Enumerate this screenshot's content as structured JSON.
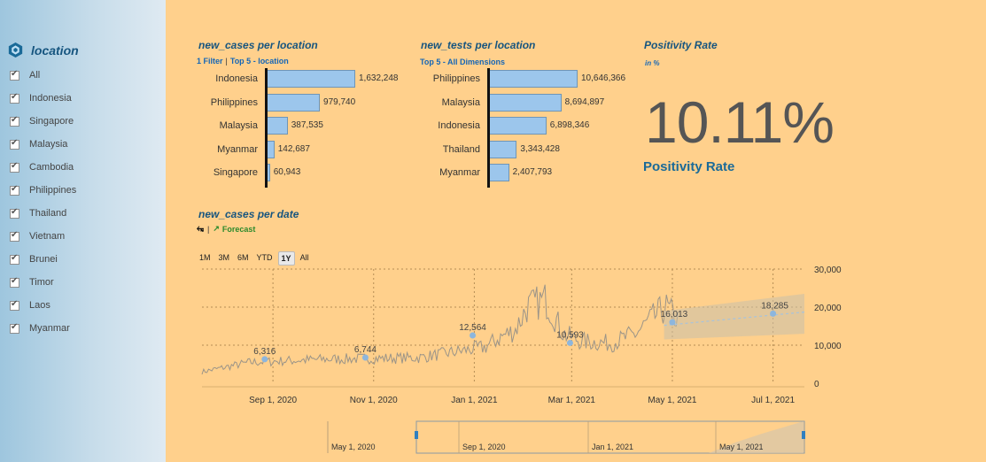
{
  "sidebar": {
    "title": "location",
    "items": [
      "All",
      "Indonesia",
      "Singapore",
      "Malaysia",
      "Cambodia",
      "Philippines",
      "Thailand",
      "Vietnam",
      "Brunei",
      "Timor",
      "Laos",
      "Myanmar"
    ]
  },
  "panel_cases": {
    "title": "new_cases per location",
    "filter_label": "1 Filter",
    "subtitle": "Top 5 - location",
    "chart_data": {
      "type": "bar",
      "categories": [
        "Indonesia",
        "Philippines",
        "Malaysia",
        "Myanmar",
        "Singapore"
      ],
      "values": [
        1632248,
        979740,
        387535,
        142687,
        60943
      ],
      "value_labels": [
        "1,632,248",
        "979,740",
        "387,535",
        "142,687",
        "60,943"
      ]
    }
  },
  "panel_tests": {
    "title": "new_tests per location",
    "subtitle": "Top 5 - All Dimensions",
    "chart_data": {
      "type": "bar",
      "categories": [
        "Philippines",
        "Malaysia",
        "Indonesia",
        "Thailand",
        "Myanmar"
      ],
      "values": [
        10646366,
        8694897,
        6898346,
        3343428,
        2407793
      ],
      "value_labels": [
        "10,646,366",
        "8,694,897",
        "6,898,346",
        "3,343,428",
        "2,407,793"
      ]
    }
  },
  "kpi": {
    "title": "Positivity Rate",
    "unit": "in %",
    "value": "10.11%",
    "label": "Positivity Rate"
  },
  "timeseries": {
    "title": "new_cases per date",
    "forecast_label": "Forecast",
    "ranges": [
      "1M",
      "3M",
      "6M",
      "YTD",
      "1Y",
      "All"
    ],
    "active_range": "1Y",
    "chart_data": {
      "type": "line",
      "y_ticks": [
        "30,000",
        "20,000",
        "10,000",
        "0"
      ],
      "ylim": [
        0,
        30000
      ],
      "x_ticks": [
        "Sep 1, 2020",
        "Nov 1, 2020",
        "Jan 1, 2021",
        "Mar 1, 2021",
        "May 1, 2021",
        "Jul 1, 2021"
      ],
      "annotations": [
        {
          "x": "2020-08-27",
          "value": 6316,
          "label": "6,316"
        },
        {
          "x": "2020-10-27",
          "value": 6744,
          "label": "6,744"
        },
        {
          "x": "2020-12-31",
          "value": 12564,
          "label": "12,564"
        },
        {
          "x": "2021-02-28",
          "value": 10593,
          "label": "10,593"
        },
        {
          "x": "2021-05-01",
          "value": 16013,
          "label": "16,013"
        },
        {
          "x": "2021-07-01",
          "value": 18285,
          "label": "18,285"
        }
      ],
      "forecast_start": "2021-04-26"
    },
    "navigator_ticks": [
      "May 1, 2020",
      "Sep 1, 2020",
      "Jan 1, 2021",
      "May 1, 2021"
    ]
  }
}
